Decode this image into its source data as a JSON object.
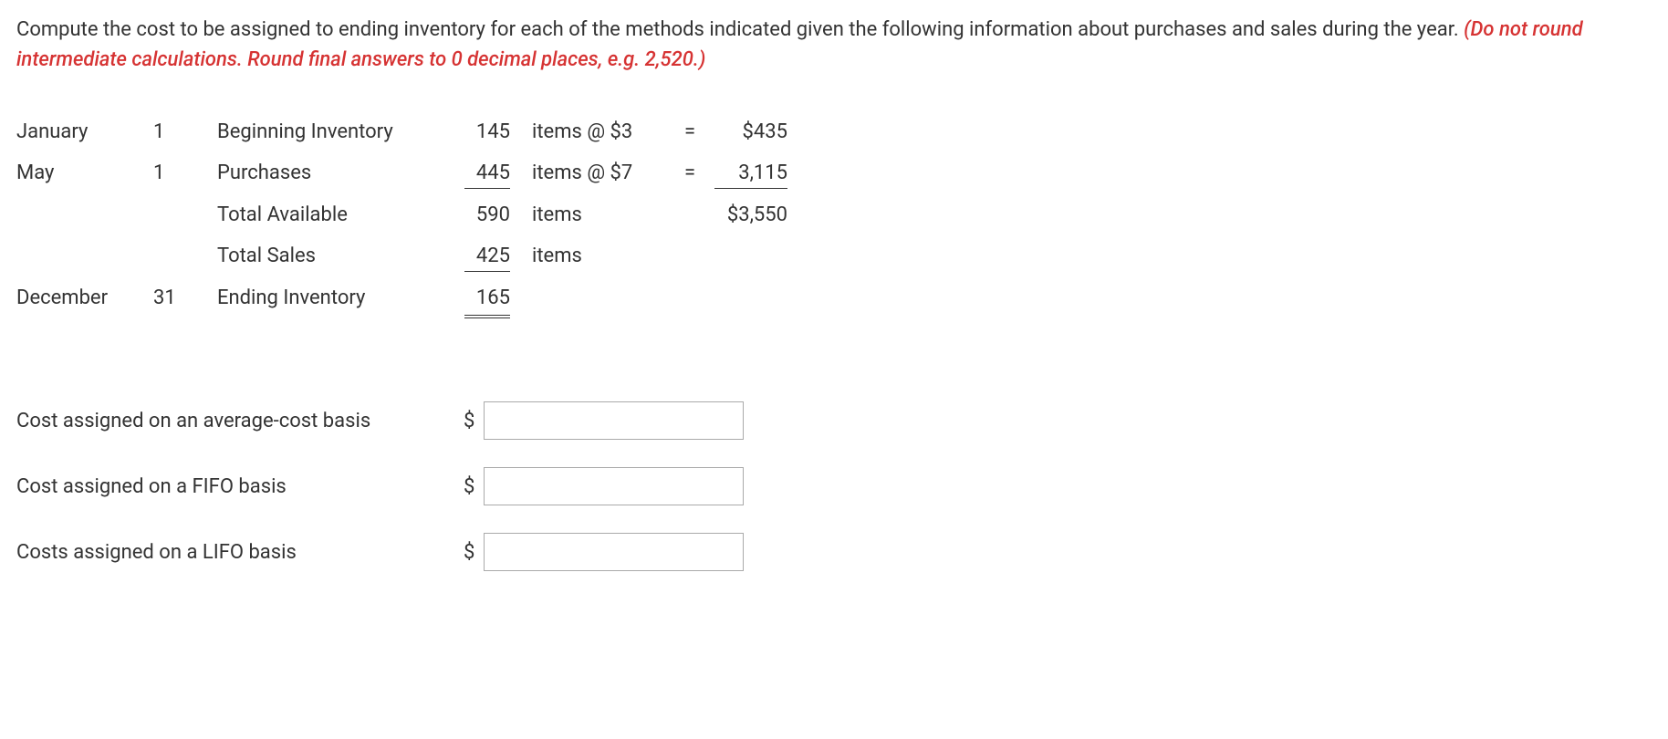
{
  "instruction": {
    "main": "Compute the cost to be assigned to ending inventory for each of the methods indicated given the following information about purchases and sales during the year. ",
    "emphasis": "(Do not round intermediate calculations. Round final answers to 0 decimal places, e.g. 2,520.)"
  },
  "rows": {
    "r1": {
      "month": "January",
      "day": "1",
      "desc": "Beginning Inventory",
      "qty": "145",
      "items_label": "items @ $3",
      "eq": "=",
      "amount": "$435"
    },
    "r2": {
      "month": "May",
      "day": "1",
      "desc": "Purchases",
      "qty": "445",
      "items_label": "items @ $7",
      "eq": "=",
      "amount": "3,115"
    },
    "r3": {
      "desc": "Total Available",
      "qty": "590",
      "items_label": "items",
      "amount": "$3,550"
    },
    "r4": {
      "desc": "Total Sales",
      "qty": "425",
      "items_label": "items"
    },
    "r5": {
      "month": "December",
      "day": "31",
      "desc": "Ending Inventory",
      "qty": "165"
    }
  },
  "answers": {
    "avg_label": "Cost assigned on an average-cost basis",
    "fifo_label": "Cost assigned on a FIFO basis",
    "lifo_label": "Costs assigned on a LIFO basis",
    "dollar": "$"
  }
}
